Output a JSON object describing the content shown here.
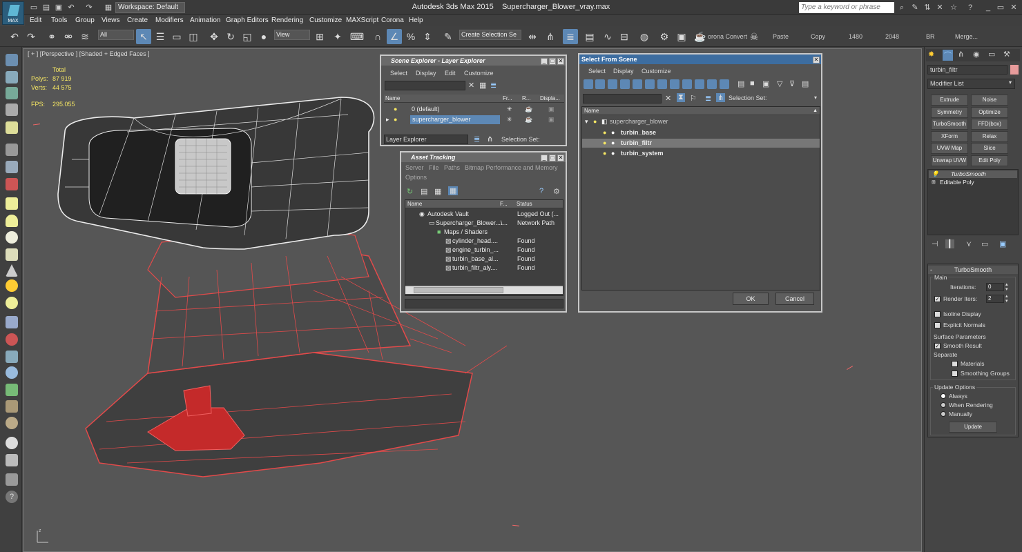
{
  "title_bar": {
    "app": "Autodesk 3ds Max  2015",
    "file": "Supercharger_Blower_vray.max",
    "workspace": "Workspace: Default",
    "logo": "MAX",
    "search_placeholder": "Type a keyword or phrase"
  },
  "menubar": [
    "Edit",
    "Tools",
    "Group",
    "Views",
    "Create",
    "Modifiers",
    "Animation",
    "Graph Editors",
    "Rendering",
    "Customize",
    "MAXScript",
    "Corona",
    "Help"
  ],
  "toolbar": {
    "filter": "All",
    "coord": "View",
    "selection_set": "Create Selection Se",
    "corona_convert": "orona Convert",
    "paste": "Paste",
    "copy": "Copy",
    "w": "1480",
    "h": "2048",
    "br": "BR",
    "merge": "Merge..."
  },
  "viewport": {
    "label": "[ + ] [Perspective ] [Shaded + Edged Faces ]",
    "total_label": "Total",
    "polys_label": "Polys:",
    "polys": "87 919",
    "verts_label": "Verts:",
    "verts": "44 575",
    "fps_label": "FPS:",
    "fps": "295.055"
  },
  "scene_explorer": {
    "title": "Scene Explorer - Layer Explorer",
    "menu": [
      "Select",
      "Display",
      "Edit",
      "Customize"
    ],
    "columns": [
      "Name",
      "Fr...",
      "R...",
      "Displa..."
    ],
    "rows": [
      "0 (default)",
      "supercharger_blower"
    ],
    "layer_dropdown": "Layer Explorer",
    "selection_set_label": "Selection Set:"
  },
  "asset_tracking": {
    "title": "Asset Tracking",
    "menu": [
      "Server",
      "File",
      "Paths",
      "Bitmap Performance and Memory"
    ],
    "menu2": "Options",
    "columns": [
      "Name",
      "F...",
      "Status"
    ],
    "rows": [
      {
        "name": "Autodesk Vault",
        "f": "",
        "status": "Logged Out (..."
      },
      {
        "name": "Supercharger_Blower....",
        "f": "\\...",
        "status": "Network Path"
      },
      {
        "name": "Maps / Shaders",
        "f": "",
        "status": ""
      },
      {
        "name": "cylinder_head....",
        "f": "",
        "status": "Found"
      },
      {
        "name": "engine_turbin_...",
        "f": "",
        "status": "Found"
      },
      {
        "name": "turbin_base_al...",
        "f": "",
        "status": "Found"
      },
      {
        "name": "turbin_filtr_aly....",
        "f": "",
        "status": "Found"
      }
    ]
  },
  "select_from_scene": {
    "title": "Select From Scene",
    "menu": [
      "Select",
      "Display",
      "Customize"
    ],
    "selection_set_label": "Selection Set:",
    "column": "Name",
    "root": "supercharger_blower",
    "children": [
      "turbin_base",
      "turbin_filtr",
      "turbin_system"
    ],
    "ok": "OK",
    "cancel": "Cancel"
  },
  "command_panel": {
    "object_name": "turbin_filtr",
    "modifier_list": "Modifier List",
    "modifier_buttons": [
      "Extrude",
      "Noise",
      "Symmetry",
      "Optimize",
      "TurboSmooth",
      "FFD(box)",
      "XForm",
      "Relax",
      "UVW Map",
      "Slice",
      "Unwrap UVW",
      "Edit Poly"
    ],
    "stack": [
      "TurboSmooth",
      "Editable Poly"
    ],
    "rollout_title": "TurboSmooth",
    "main_label": "Main",
    "iterations_label": "Iterations:",
    "iterations": "0",
    "render_iters_label": "Render Iters:",
    "render_iters": "2",
    "isoline": "Isoline Display",
    "explicit": "Explicit Normals",
    "surface_label": "Surface Parameters",
    "smooth_result": "Smooth Result",
    "separate_label": "Separate",
    "materials": "Materials",
    "smoothing_groups": "Smoothing Groups",
    "update_options_label": "Update Options",
    "always": "Always",
    "when_rendering": "When Rendering",
    "manually": "Manually",
    "update_btn": "Update"
  }
}
